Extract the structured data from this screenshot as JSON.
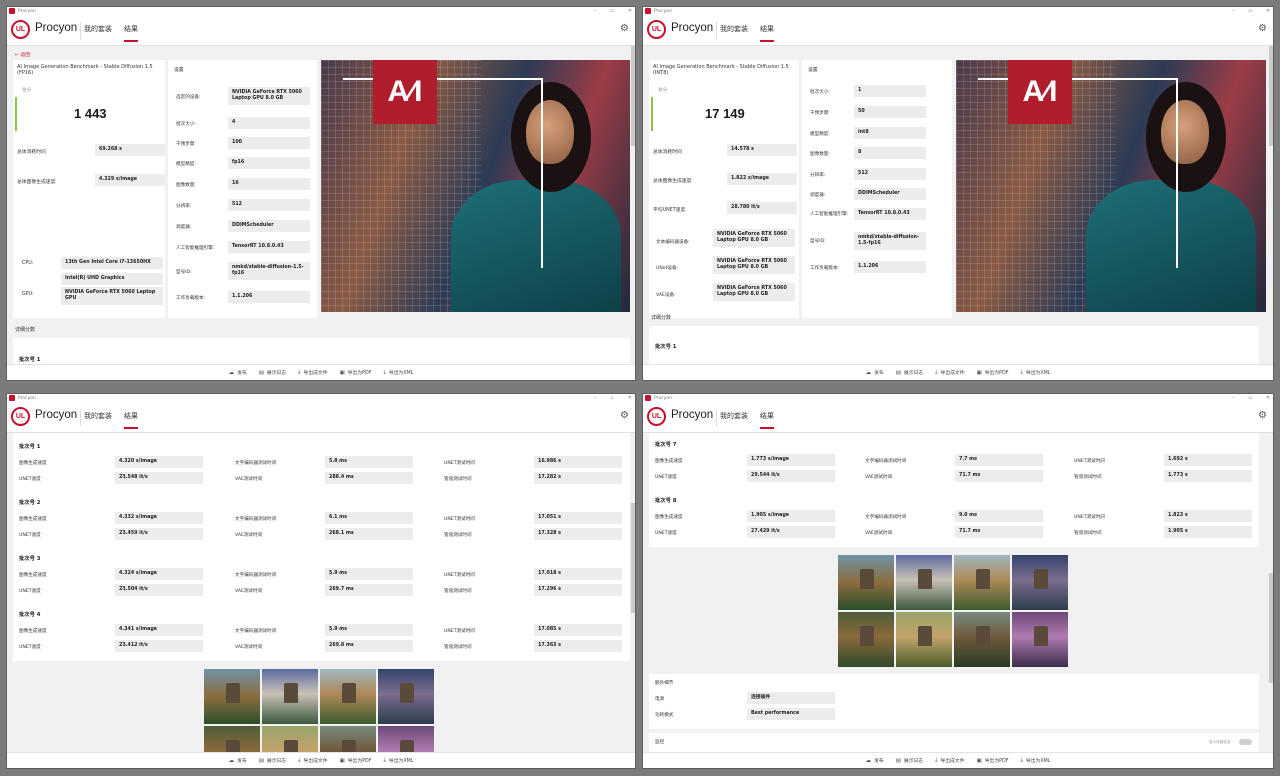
{
  "app": {
    "title": "Procyon",
    "brand": "Procyon",
    "logo": "UL",
    "nav_my_suite": "我的套装",
    "nav_results": "结果"
  },
  "bottom_bar": [
    "发布",
    "展示日志",
    "导出成文件",
    "导出为PDF",
    "导出为XML"
  ],
  "back_label": "← 返回",
  "win1": {
    "test_title": "AI Image Generation Benchmark - Stable Diffusion 1.5 (FP16)",
    "score_label": "总分",
    "score": "1 443",
    "total_time_label": "总体消耗时间",
    "total_time": "69.268 s",
    "speed_label": "总体图像生成速度",
    "speed": "4.329 s/image",
    "cpu_label": "CPU:",
    "cpu": "13th Gen Intel Core i7-13650HX",
    "gpu_label": "GPU:",
    "gpu_igpu": "Intel(R) UHD Graphics",
    "gpu_dgpu": "NVIDIA GeForce RTX 5060 Laptop GPU",
    "settings_title": "设置",
    "settings": [
      {
        "label": "选定的设备:",
        "value": "NVIDIA GeForce RTX 5060 Laptop GPU 8.0 GB"
      },
      {
        "label": "批次大小:",
        "value": "4"
      },
      {
        "label": "干预步骤:",
        "value": "100"
      },
      {
        "label": "模型精度:",
        "value": "fp16"
      },
      {
        "label": "图像数量:",
        "value": "16"
      },
      {
        "label": "分辨率:",
        "value": "512"
      },
      {
        "label": "调度器:",
        "value": "DDIMScheduler"
      },
      {
        "label": "人工智能推理引擎:",
        "value": "TensorRT 10.8.0.43"
      },
      {
        "label": "型号ID:",
        "value": "nmkd/stable-diffusion-1.5-fp16"
      },
      {
        "label": "工作负载版本:",
        "value": "1.1.206"
      }
    ],
    "detail_title": "详细分数",
    "batch1": "批次号 1"
  },
  "win2": {
    "test_title": "AI Image Generation Benchmark - Stable Diffusion 1.5 (INT8)",
    "score_label": "总分",
    "score": "17 149",
    "total_time_label": "总体消耗时间",
    "total_time": "14.578 s",
    "speed_label": "总体图像生成速度",
    "speed": "1.822 s/image",
    "unet_label": "平均UNET速度",
    "unet": "28.780 it/s",
    "devices": [
      {
        "label": "文本编码器设备:",
        "value": "NVIDIA GeForce RTX 5060 Laptop GPU 8.0 GB"
      },
      {
        "label": "UNet设备:",
        "value": "NVIDIA GeForce RTX 5060 Laptop GPU 8.0 GB"
      },
      {
        "label": "VAE设备:",
        "value": "NVIDIA GeForce RTX 5060 Laptop GPU 8.0 GB"
      }
    ],
    "settings_title": "设置",
    "settings": [
      {
        "label": "批次大小:",
        "value": "1"
      },
      {
        "label": "干预步骤:",
        "value": "50"
      },
      {
        "label": "模型精度:",
        "value": "int8"
      },
      {
        "label": "图像数量:",
        "value": "8"
      },
      {
        "label": "分辨率:",
        "value": "512"
      },
      {
        "label": "调度器:",
        "value": "DDIMScheduler"
      },
      {
        "label": "人工智能推理引擎:",
        "value": "TensorRT 10.8.0.43"
      },
      {
        "label": "型号ID:",
        "value": "nmkd/stable-diffusion-1.5-fp16"
      },
      {
        "label": "工作负载版本:",
        "value": "1.1.206"
      }
    ],
    "detail_title": "详细分数",
    "batch1": "批次号 1"
  },
  "labels": {
    "img_speed": "图像生成速度",
    "unet_speed": "UNET速度",
    "text_enc_time": "文字编码器测试时间",
    "vae_time": "VAE测试时间",
    "unet_time": "UNET测试时间",
    "pipeline_time": "管道测试时间"
  },
  "win3": {
    "batches": [
      {
        "title": "批次号 1",
        "img_speed": "4.320 s/image",
        "unet_speed": "23.548 it/s",
        "text_enc": "5.8 ms",
        "vae": "288.4 ms",
        "unet_time": "16.986 s",
        "pipeline": "17.282 s"
      },
      {
        "title": "批次号 2",
        "img_speed": "4.332 s/image",
        "unet_speed": "23.459 it/s",
        "text_enc": "6.1 ms",
        "vae": "268.1 ms",
        "unet_time": "17.051 s",
        "pipeline": "17.328 s"
      },
      {
        "title": "批次号 3",
        "img_speed": "4.324 s/image",
        "unet_speed": "23.504 it/s",
        "text_enc": "5.9 ms",
        "vae": "269.7 ms",
        "unet_time": "17.018 s",
        "pipeline": "17.296 s"
      },
      {
        "title": "批次号 4",
        "img_speed": "4.341 s/image",
        "unet_speed": "23.412 it/s",
        "text_enc": "5.9 ms",
        "vae": "269.8 ms",
        "unet_time": "17.085 s",
        "pipeline": "17.363 s"
      }
    ]
  },
  "win4": {
    "batches": [
      {
        "title": "批次号 7",
        "img_speed": "1.773 s/image",
        "unet_speed": "29.544 it/s",
        "text_enc": "7.7 ms",
        "vae": "71.7 ms",
        "unet_time": "1.692 s",
        "pipeline": "1.773 s"
      },
      {
        "title": "批次号 8",
        "img_speed": "1.905 s/image",
        "unet_speed": "27.429 it/s",
        "text_enc": "9.0 ms",
        "vae": "71.7 ms",
        "unet_time": "1.823 s",
        "pipeline": "1.905 s"
      }
    ],
    "extra_title": "额外细节",
    "power_label": "电源",
    "power": "连接插件",
    "power_mode_label": "功耗模式",
    "power_mode": "Best performance",
    "monitor_title": "监控",
    "monitor_toggle_label": "显示详细信息"
  }
}
